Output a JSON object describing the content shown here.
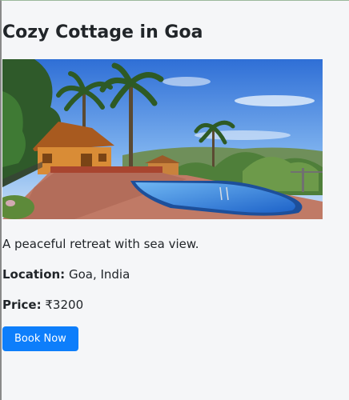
{
  "listing": {
    "title": "Cozy Cottage in Goa",
    "description": "A peaceful retreat with sea view.",
    "location_label": "Location:",
    "location_value": "Goa, India",
    "price_label": "Price:",
    "price_value": "₹3200",
    "book_button_label": "Book Now"
  },
  "colors": {
    "button": "#0d7efb",
    "background": "#f5f6f8"
  }
}
